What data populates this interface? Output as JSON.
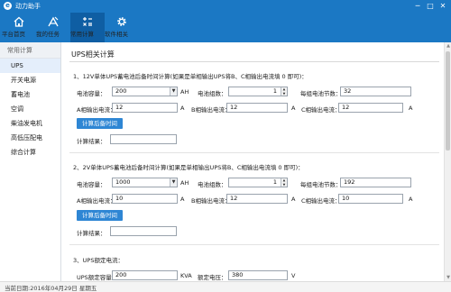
{
  "app": {
    "title": "动力助手",
    "logo_letter": "e"
  },
  "window_controls": {
    "minimize": "─",
    "maximize": "□",
    "close": "✕"
  },
  "toolbar": {
    "items": [
      {
        "label": "平台首页",
        "icon": "home-icon"
      },
      {
        "label": "我的任务",
        "icon": "task-icon"
      },
      {
        "label": "常用计算",
        "icon": "calculator-icon"
      },
      {
        "label": "软件相关",
        "icon": "gear-icon"
      }
    ],
    "active_index": 2
  },
  "sidebar": {
    "header": "常用计算",
    "items": [
      "UPS",
      "开关电源",
      "蓄电池",
      "空调",
      "柴油发电机",
      "高低压配电",
      "综合计算"
    ],
    "active_index": 0
  },
  "main": {
    "title": "UPS相关计算",
    "section1": {
      "title": "1、12V单体UPS蓄电池后备时间计算(如果是单相输出UPS将B、C相输出电流填 0 即可)：",
      "capacity_label": "电池容量：",
      "capacity_value": "200",
      "capacity_unit": "AH",
      "groups_label": "电池组数：",
      "groups_value": "1",
      "cells_label": "每组电池节数：",
      "cells_value": "32",
      "a_label": "A相输出电流：",
      "a_value": "12",
      "a_unit": "A",
      "b_label": "B相输出电流：",
      "b_value": "12",
      "b_unit": "A",
      "c_label": "C相输出电流：",
      "c_value": "12",
      "c_unit": "A",
      "button": "计算后备时间",
      "result_label": "计算结果：",
      "result_value": ""
    },
    "section2": {
      "title": "2、2V单体UPS蓄电池后备时间计算(如果是单相输出UPS将B、C相输出电流填 0 即可)：",
      "capacity_label": "电池容量：",
      "capacity_value": "1000",
      "capacity_unit": "AH",
      "groups_label": "电池组数：",
      "groups_value": "1",
      "cells_label": "每组电池节数：",
      "cells_value": "192",
      "a_label": "A相输出电流：",
      "a_value": "10",
      "a_unit": "A",
      "b_label": "B相输出电流：",
      "b_value": "12",
      "b_unit": "A",
      "c_label": "C相输出电流：",
      "c_value": "10",
      "c_unit": "A",
      "button": "计算后备时间",
      "result_label": "计算结果：",
      "result_value": ""
    },
    "section3": {
      "title": "3、UPS额定电流：",
      "capacity_label": "UPS额定容量：",
      "capacity_value": "200",
      "capacity_unit": "KVA",
      "voltage_label": "额定电压：",
      "voltage_value": "380",
      "voltage_unit": "V"
    }
  },
  "scrollbar": {
    "up": "▲",
    "down": "▼"
  },
  "statusbar": {
    "text": "当前日期:2016年04月29日 星期五"
  }
}
